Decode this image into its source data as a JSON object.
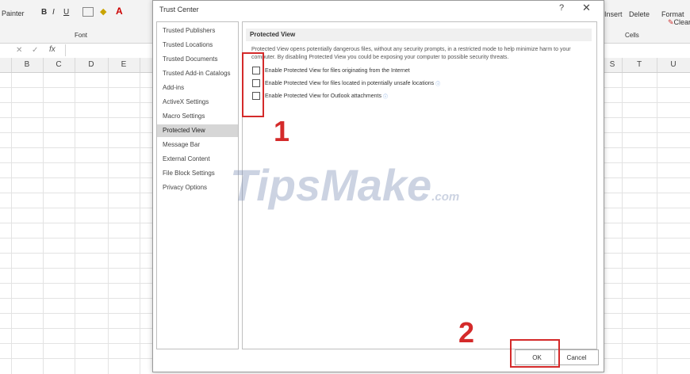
{
  "excel": {
    "ribbon": {
      "painter_label": "Painter",
      "font_group": "Font",
      "bold": "B",
      "italic": "I",
      "underline": "U",
      "insert": "Insert",
      "delete": "Delete",
      "format": "Format",
      "cells_group": "Cells",
      "clear": "Clear"
    },
    "formula": {
      "fx": "fx",
      "cancel": "✕",
      "enter": "✓"
    },
    "columns_left": [
      "B",
      "C",
      "D",
      "E"
    ],
    "columns_right": [
      "S",
      "T",
      "U"
    ]
  },
  "dialog": {
    "title": "Trust Center",
    "help": "?",
    "close": "✕",
    "nav": [
      "Trusted Publishers",
      "Trusted Locations",
      "Trusted Documents",
      "Trusted Add-in Catalogs",
      "Add-ins",
      "ActiveX Settings",
      "Macro Settings",
      "Protected View",
      "Message Bar",
      "External Content",
      "File Block Settings",
      "Privacy Options"
    ],
    "selected_nav": "Protected View",
    "section_title": "Protected View",
    "description": "Protected View opens potentially dangerous files, without any security prompts, in a restricted mode to help minimize harm to your computer. By disabling Protected View you could be exposing your computer to possible security threats.",
    "options": [
      {
        "label": "Enable Protected View for files originating from the Internet",
        "checked": false
      },
      {
        "label": "Enable Protected View for files located in potentially unsafe locations",
        "checked": false
      },
      {
        "label": "Enable Protected View for Outlook attachments",
        "checked": false
      }
    ],
    "ok": "OK",
    "cancel": "Cancel"
  },
  "annotations": {
    "step1": "1",
    "step2": "2",
    "watermark_main": "TipsMake",
    "watermark_suffix": ".com"
  },
  "colors": {
    "annotation_red": "#d42a2a",
    "selected_nav_bg": "#d6d6d6"
  }
}
